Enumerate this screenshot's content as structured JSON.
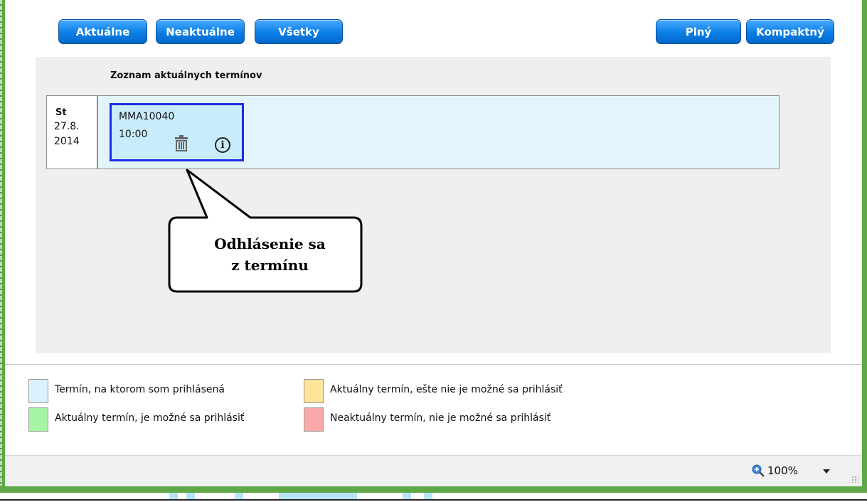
{
  "toolbar": {
    "filter_buttons": [
      "Aktuálne",
      "Neaktuálne",
      "Všetky"
    ],
    "view_buttons": [
      "Plný",
      "Kompaktný"
    ]
  },
  "list": {
    "title": "Zoznam aktuálnych termínov",
    "rows": [
      {
        "day": "St",
        "date_line1": "27.8.",
        "date_line2": "2014",
        "event": {
          "code": "MMA10040",
          "time": "10:00",
          "icons": [
            "trash-icon",
            "info-icon"
          ],
          "highlight_color": "#1a2ee0"
        }
      }
    ]
  },
  "callout": {
    "line1": "Odhlásenie sa",
    "line2": "z termínu"
  },
  "legend": [
    {
      "color": "#d9f2fc",
      "label": "Termín, na ktorom som prihlásená"
    },
    {
      "color": "#fde49a",
      "label": "Aktuálny termín, ešte nie je možné sa prihlásiť"
    },
    {
      "color": "#a5f5a5",
      "label": "Aktuálny termín, je možné sa prihlásiť"
    },
    {
      "color": "#f9a9a9",
      "label": "Neaktuálny termín, nie je možné sa prihlásiť"
    }
  ],
  "statusbar": {
    "zoom": "100%",
    "zoom_icon": "zoom-icon"
  },
  "colors": {
    "button_blue": "#0a7ee6",
    "frame_green": "#5ea847",
    "row_bg": "#e3f5fc"
  }
}
